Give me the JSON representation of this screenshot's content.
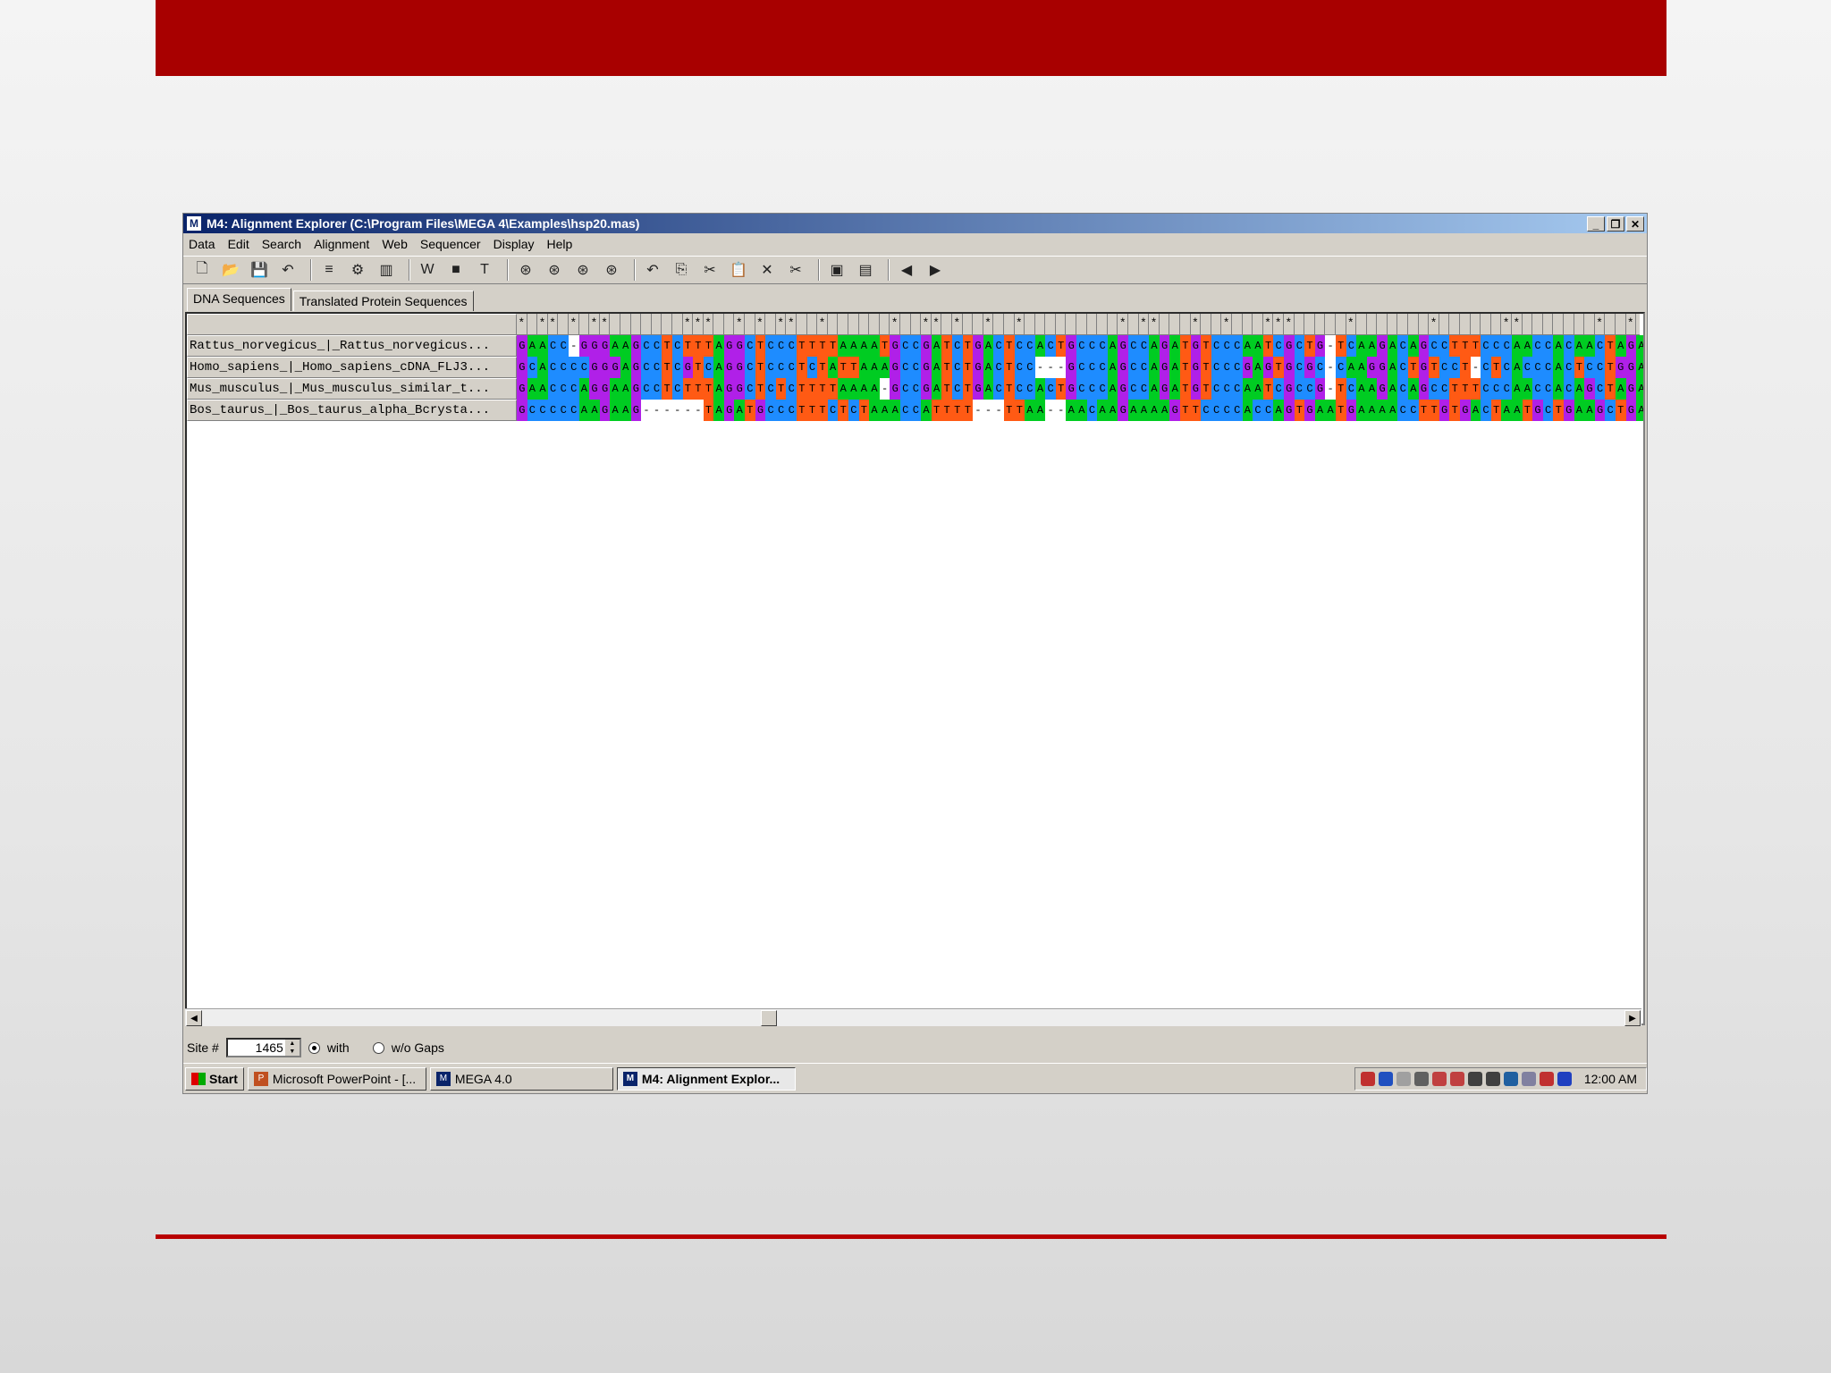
{
  "window": {
    "app_icon": "M",
    "title": "M4: Alignment Explorer (C:\\Program Files\\MEGA 4\\Examples\\hsp20.mas)",
    "controls": [
      "minimize-icon",
      "restore-icon",
      "close-icon"
    ]
  },
  "menu": [
    "Data",
    "Edit",
    "Search",
    "Alignment",
    "Web",
    "Sequencer",
    "Display",
    "Help"
  ],
  "toolbar_icons": [
    "new-file-icon",
    "open-folder-icon",
    "save-icon",
    "undo-uf-icon",
    "sep",
    "align-clustal-icon",
    "align-muscle-icon",
    "sequencer-icon",
    "sep",
    "w-icon",
    "color-icon",
    "t-icon",
    "sep",
    "find-binoculars-icon",
    "find-prev-icon",
    "find-next-icon",
    "find-motif-icon",
    "sep",
    "undo-icon",
    "copy-icon",
    "cut-icon",
    "paste-icon",
    "delete-icon",
    "delete-gaps-icon",
    "sep",
    "mark-icon",
    "export-icon",
    "sep",
    "prev-arrow-icon",
    "next-arrow-icon"
  ],
  "tabs": [
    "DNA Sequences",
    "Translated Protein Sequences"
  ],
  "consensus": "*.**.*.**.......***..*.*.**..*......*..**.*..*..*.........*.**...*..*...***.....*.......*......**.......*..*.........**",
  "sequences": [
    {
      "name": "Rattus_norvegicus_|_Rattus_norvegicus...",
      "seq": "GAACC-GGGAAGCCTCTTTAGGCTCCCTTTTAAAATGCCGATCTGACTCCACTGCCCAGCCAGATGTCCCAATCGCTG-TCAAGACAGCCTTTCCCAACCACAACTAGA"
    },
    {
      "name": "Homo_sapiens_|_Homo_sapiens_cDNA_FLJ3...",
      "seq": "GCACCCCGGGAGCCTCGTCAGGCTCCCTCTATTAAAGCCGATCTGACTCC---GCCCAGCCAGATGTCCCGAGTGCGC-CAAGGACTGTCCT-CTCACCCACTCCTGGA"
    },
    {
      "name": "Mus_musculus_|_Mus_musculus_similar_t...",
      "seq": "GAACCCAGGAAGCCTCTTTAGGCTCTCTTTTAAAA-GCCGATCTGACTCCACTGCCCAGCCAGATGTCCCAATCGCCG-TCAAGACAGCCTTTCCCAACCACAGCTAGA"
    },
    {
      "name": "Bos_taurus_|_Bos_taurus_alpha_Bcrysta...",
      "seq": "GCCCCCAAGAAG------TAGATGCCCTTTCTCTAAACCATTTT---TTAA--AACAAGAAAAGTTCCCCACCAGTGAATGAAAACCTTGTGACTAATGCTGAAGCTGA"
    }
  ],
  "base_colors": {
    "A": "#00cc22",
    "C": "#1e8cff",
    "G": "#b020e8",
    "T": "#ff5a14",
    "-": "#ffffff"
  },
  "status": {
    "site_label": "Site #",
    "site_value": "1465",
    "with_label": "with",
    "wo_label": "w/o Gaps",
    "selected": "with"
  },
  "taskbar": {
    "start": "Start",
    "tasks": [
      {
        "label": "Microsoft PowerPoint - [...",
        "icon": "powerpoint-icon",
        "active": false
      },
      {
        "label": "MEGA 4.0",
        "icon": "mega-icon",
        "active": false
      },
      {
        "label": "M4: Alignment Explor...",
        "icon": "mega-icon",
        "active": true
      }
    ],
    "tray_icons": [
      "pin-icon",
      "bluetooth-icon",
      "network-icon",
      "sound-icon",
      "monitor-icon",
      "display-icon",
      "lock-icon",
      "printer-icon",
      "pen-icon",
      "link-icon",
      "wifi-icon",
      "tablet-icon"
    ],
    "tray_colors": [
      "#c03030",
      "#2050c0",
      "#a0a0a0",
      "#606060",
      "#c04040",
      "#c04040",
      "#404040",
      "#404040",
      "#2060a0",
      "#8080a0",
      "#c03030",
      "#2040c0"
    ],
    "clock": "12:00 AM"
  }
}
